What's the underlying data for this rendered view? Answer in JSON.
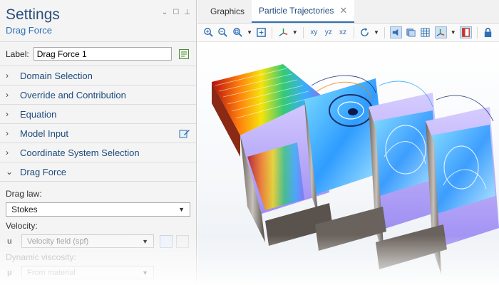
{
  "settings": {
    "title": "Settings",
    "subtitle": "Drag Force",
    "label_caption": "Label:",
    "label_value": "Drag Force 1",
    "sections": [
      {
        "label": "Domain Selection",
        "chevron": "›"
      },
      {
        "label": "Override and Contribution",
        "chevron": "›"
      },
      {
        "label": "Equation",
        "chevron": "›"
      },
      {
        "label": "Model Input",
        "chevron": "›"
      },
      {
        "label": "Coordinate System Selection",
        "chevron": "›"
      }
    ],
    "drag_force": {
      "header": "Drag Force",
      "chevron": "⌄",
      "drag_law_label": "Drag law:",
      "drag_law_value": "Stokes",
      "velocity_label": "Velocity:",
      "velocity_symbol": "u",
      "velocity_value": "Velocity field (spf)",
      "viscosity_label": "Dynamic viscosity:",
      "viscosity_symbol": "μ",
      "viscosity_value": "From material"
    }
  },
  "graphics": {
    "tabs": [
      {
        "label": "Graphics",
        "active": false
      },
      {
        "label": "Particle Trajectories",
        "active": true
      }
    ],
    "close_glyph": "✕",
    "toolbar_icons": [
      "zoom-in-icon",
      "zoom-out-icon",
      "zoom-box-icon",
      "zoom-extents-icon",
      "axis-orientation-icon",
      "view-xy-icon",
      "view-yz-icon",
      "view-xz-icon",
      "rotate-icon",
      "scene-light-icon",
      "transparency-icon",
      "grid-icon",
      "axis-triad-icon",
      "wireframe-icon",
      "lock-icon"
    ],
    "toolbar_labels": {
      "xy": "xy",
      "yz": "yz",
      "xz": "xz"
    }
  },
  "colors": {
    "accent": "#2d6fb3",
    "title": "#2b4f7a",
    "section_text": "#1e4a7d"
  }
}
